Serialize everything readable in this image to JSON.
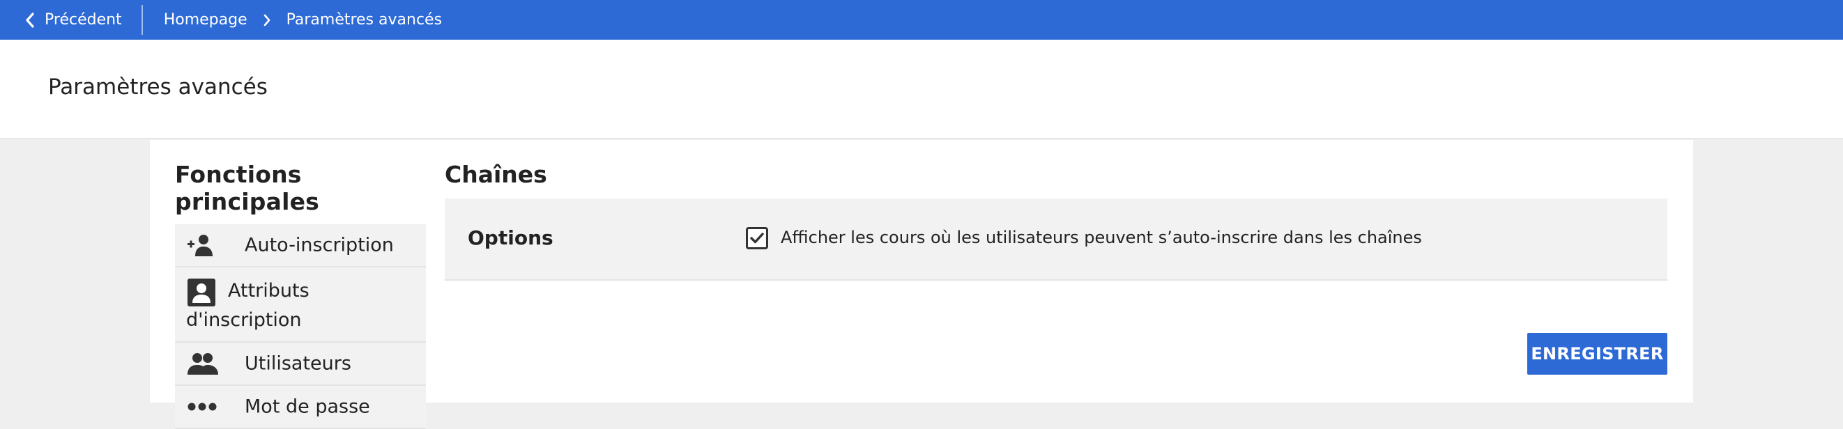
{
  "topbar": {
    "back_label": "Précédent",
    "breadcrumb": [
      {
        "label": "Homepage"
      },
      {
        "label": "Paramètres avancés"
      }
    ]
  },
  "page": {
    "title": "Paramètres avancés"
  },
  "sidebar": {
    "heading": "Fonctions principales",
    "items": [
      {
        "label": "Auto-inscription",
        "icon": "user-add-icon"
      },
      {
        "label": "Attributs d'inscription",
        "icon": "user-badge-icon"
      },
      {
        "label": "Utilisateurs",
        "icon": "users-icon"
      },
      {
        "label": "Mot de passe",
        "icon": "password-dots-icon"
      }
    ]
  },
  "main": {
    "heading": "Chaînes",
    "options_label": "Options",
    "option_checkbox": {
      "label": "Afficher les cours où les utilisateurs peuvent s’auto-inscrire dans les chaînes",
      "checked": true
    },
    "save_label": "ENREGISTRER"
  },
  "colors": {
    "brand": "#2d6ad5",
    "panel": "#ffffff",
    "row_bg": "#f2f2f2",
    "page_bg": "#efefef"
  }
}
